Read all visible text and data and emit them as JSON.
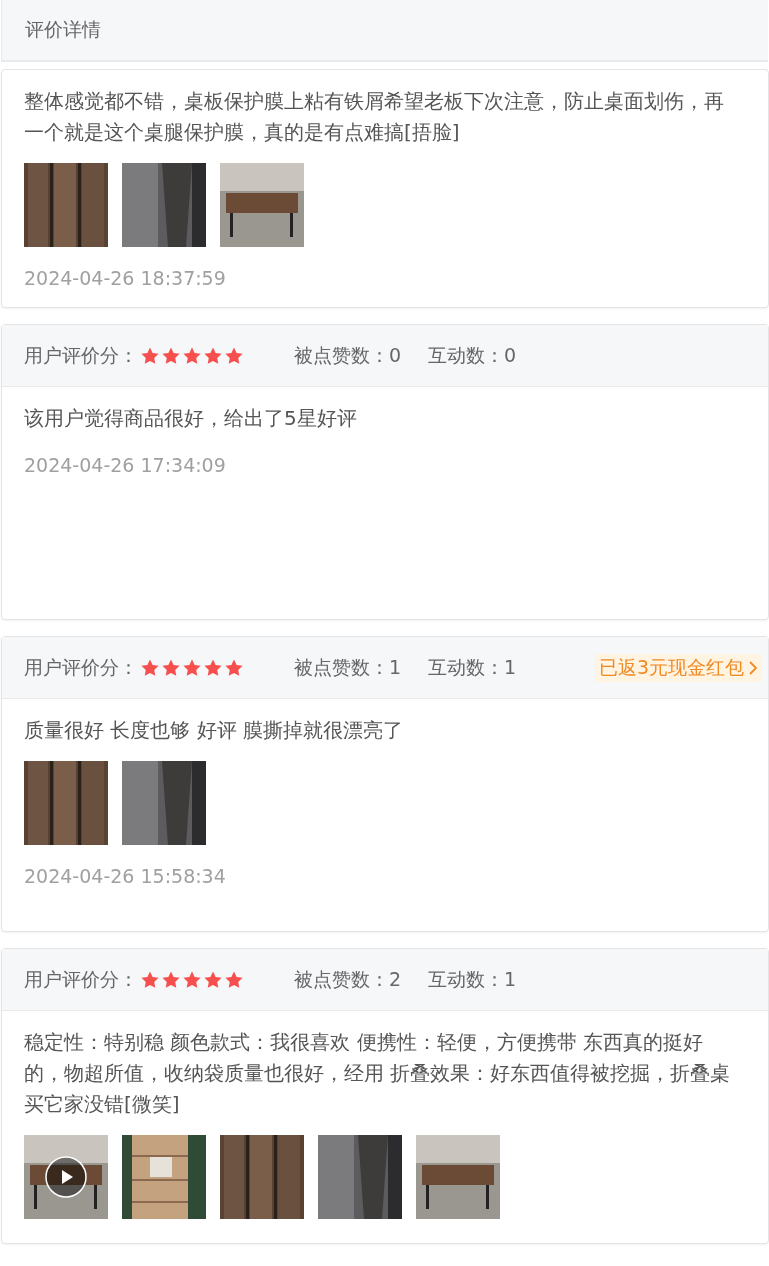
{
  "header": {
    "title": "评价详情"
  },
  "reviews": [
    {
      "text": "整体感觉都不错，桌板保护膜上粘有铁屑希望老板下次注意，防止桌面划伤，再一个就是这个桌腿保护膜，真的是有点难搞[捂脸]",
      "media": [
        {
          "kind": "picture"
        },
        {
          "kind": "picture"
        },
        {
          "kind": "picture"
        }
      ],
      "time": "2024-04-26 18:37:59"
    },
    {
      "score_label": "用户评价分：",
      "stars": 5,
      "likes": "被点赞数：0",
      "interactions": "互动数：0",
      "text": "该用户觉得商品很好，给出了5星好评",
      "time": "2024-04-26 17:34:09"
    },
    {
      "score_label": "用户评价分：",
      "stars": 5,
      "likes": "被点赞数：1",
      "interactions": "互动数：1",
      "cashback": "已返3元现金红包",
      "text": "质量很好 长度也够 好评 膜撕掉就很漂亮了",
      "media": [
        {
          "kind": "picture"
        },
        {
          "kind": "picture"
        }
      ],
      "time": "2024-04-26 15:58:34"
    },
    {
      "score_label": "用户评价分：",
      "stars": 5,
      "likes": "被点赞数：2",
      "interactions": "互动数：1",
      "text": "稳定性：特别稳 颜色款式：我很喜欢 便携性：轻便，方便携带 东西真的挺好的，物超所值，收纳袋质量也很好，经用 折叠效果：好东西值得被挖掘，折叠桌买它家没错[微笑]",
      "media": [
        {
          "kind": "video"
        },
        {
          "kind": "picture"
        },
        {
          "kind": "picture"
        },
        {
          "kind": "picture"
        },
        {
          "kind": "picture"
        }
      ]
    }
  ]
}
